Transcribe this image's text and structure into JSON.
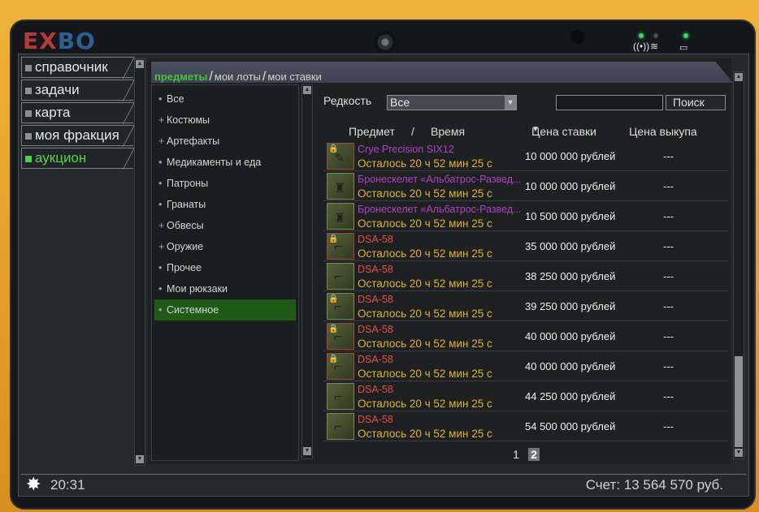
{
  "logo": {
    "ex": "EX",
    "bo": "BO"
  },
  "sidebar": {
    "items": [
      {
        "label": "справочник"
      },
      {
        "label": "задачи"
      },
      {
        "label": "карта"
      },
      {
        "label": "моя фракция"
      },
      {
        "label": "аукцион",
        "active": true
      }
    ]
  },
  "tabs": [
    {
      "label": "предметы",
      "active": true
    },
    {
      "label": "мои лоты"
    },
    {
      "label": "мои ставки"
    }
  ],
  "categories": [
    {
      "marker": "•",
      "label": "Все"
    },
    {
      "marker": "+",
      "label": "Костюмы"
    },
    {
      "marker": "+",
      "label": "Артефакты"
    },
    {
      "marker": "•",
      "label": "Медикаменты и еда"
    },
    {
      "marker": "•",
      "label": "Патроны"
    },
    {
      "marker": "•",
      "label": "Гранаты"
    },
    {
      "marker": "+",
      "label": "Обвесы"
    },
    {
      "marker": "+",
      "label": "Оружие"
    },
    {
      "marker": "•",
      "label": "Прочее"
    },
    {
      "marker": "•",
      "label": "Мои рюкзаки"
    },
    {
      "marker": "•",
      "label": "Системное",
      "active": true
    }
  ],
  "filter": {
    "rarity_label": "Редкость",
    "rarity_value": "Все",
    "search_value": "",
    "search_button": "Поиск"
  },
  "table": {
    "col_item": "Предмет",
    "col_sep": "/",
    "col_time": "Время",
    "col_bid": "Цена ставки",
    "col_bid_sort": "▼",
    "col_buyout": "Цена выкупа",
    "rows": [
      {
        "name": "Crye Precision SIX12",
        "name_color": "#b043c8",
        "time": "Осталось 20 ч 52 мин 25 с",
        "bid": "10 000 000 рублей",
        "buyout": "---",
        "locked": true,
        "icon": "weapon-icon",
        "frame": "red"
      },
      {
        "name": "Бронескелет «Альбатрос-Развед...",
        "name_color": "#b043c8",
        "time": "Осталось 20 ч 52 мин 25 с",
        "bid": "10 000 000 рублей",
        "buyout": "---",
        "locked": false,
        "icon": "armor-icon",
        "frame": "green"
      },
      {
        "name": "Бронескелет «Альбатрос-Развед...",
        "name_color": "#b043c8",
        "time": "Осталось 20 ч 52 мин 25 с",
        "bid": "10 500 000 рублей",
        "buyout": "---",
        "locked": false,
        "icon": "armor-icon",
        "frame": "green"
      },
      {
        "name": "DSA-58",
        "name_color": "#e0524a",
        "time": "Осталось 20 ч 52 мин 25 с",
        "bid": "35 000 000 рублей",
        "buyout": "---",
        "locked": true,
        "icon": "rifle-icon",
        "frame": "red"
      },
      {
        "name": "DSA-58",
        "name_color": "#e0524a",
        "time": "Осталось 20 ч 52 мин 25 с",
        "bid": "38 250 000 рублей",
        "buyout": "---",
        "locked": false,
        "icon": "rifle-icon",
        "frame": "green"
      },
      {
        "name": "DSA-58",
        "name_color": "#e0524a",
        "time": "Осталось 20 ч 52 мин 25 с",
        "bid": "39 250 000 рублей",
        "buyout": "---",
        "locked": true,
        "icon": "rifle-icon",
        "frame": "green"
      },
      {
        "name": "DSA-58",
        "name_color": "#e0524a",
        "time": "Осталось 20 ч 52 мин 25 с",
        "bid": "40 000 000 рублей",
        "buyout": "---",
        "locked": true,
        "icon": "rifle-icon",
        "frame": "red"
      },
      {
        "name": "DSA-58",
        "name_color": "#e0524a",
        "time": "Осталось 20 ч 52 мин 25 с",
        "bid": "40 000 000 рублей",
        "buyout": "---",
        "locked": true,
        "icon": "rifle-icon",
        "frame": "red"
      },
      {
        "name": "DSA-58",
        "name_color": "#e0524a",
        "time": "Осталось 20 ч 52 мин 25 с",
        "bid": "44 250 000 рублей",
        "buyout": "---",
        "locked": false,
        "icon": "rifle-icon",
        "frame": "green"
      },
      {
        "name": "DSA-58",
        "name_color": "#e0524a",
        "time": "Осталось 20 ч 52 мин 25 с",
        "bid": "54 500 000 рублей",
        "buyout": "---",
        "locked": false,
        "icon": "rifle-icon",
        "frame": "green"
      }
    ]
  },
  "pager": {
    "pages": [
      "1",
      "2"
    ],
    "current": "2"
  },
  "footer": {
    "time": "20:31",
    "account": "Счет: 13 564 570 руб."
  },
  "colors": {
    "accent_green": "#46c43e",
    "timer_gold": "#ddb43a",
    "case_yellow": "#e7a12a"
  }
}
